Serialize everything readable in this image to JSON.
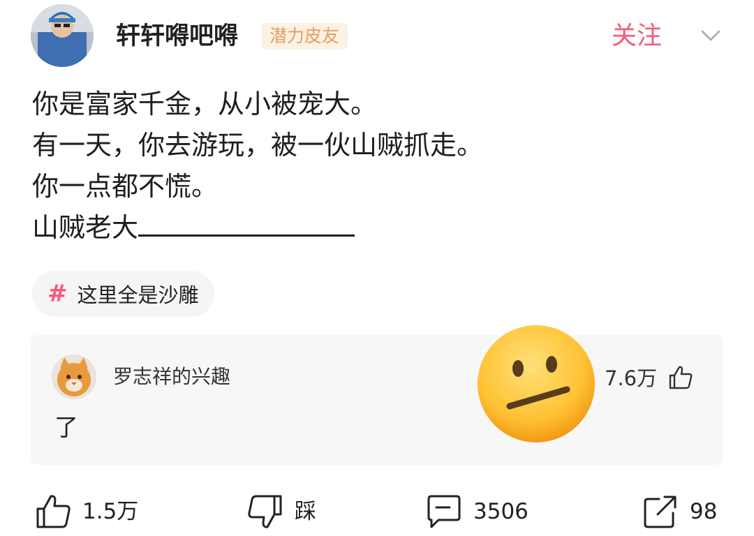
{
  "author": {
    "name": "轩轩嘚吧嘚",
    "badge": "潜力皮友"
  },
  "header": {
    "follow_label": "关注"
  },
  "post": {
    "lines": [
      "你是富家千金，从小被宠大。",
      "有一天，你去游玩，被一伙山贼抓走。",
      "你一点都不慌。",
      "山贼老大"
    ]
  },
  "topic": {
    "label": "这里全是沙雕"
  },
  "top_comment": {
    "author": "罗志祥的兴趣",
    "text": "了",
    "likes": "7.6万"
  },
  "actions": {
    "like_count": "1.5万",
    "dislike_label": "踩",
    "comment_count": "3506",
    "share_count": "98"
  },
  "colors": {
    "accent": "#f55a7a",
    "badge_text": "#e0a060",
    "badge_bg": "#fdf1e3",
    "card_bg": "#f7f7f8"
  },
  "icons": [
    "chevron-down-icon",
    "hashtag-icon",
    "thumbs-up-icon",
    "thumbs-down-icon",
    "comment-icon",
    "share-icon",
    "neutral-face-emoji"
  ]
}
